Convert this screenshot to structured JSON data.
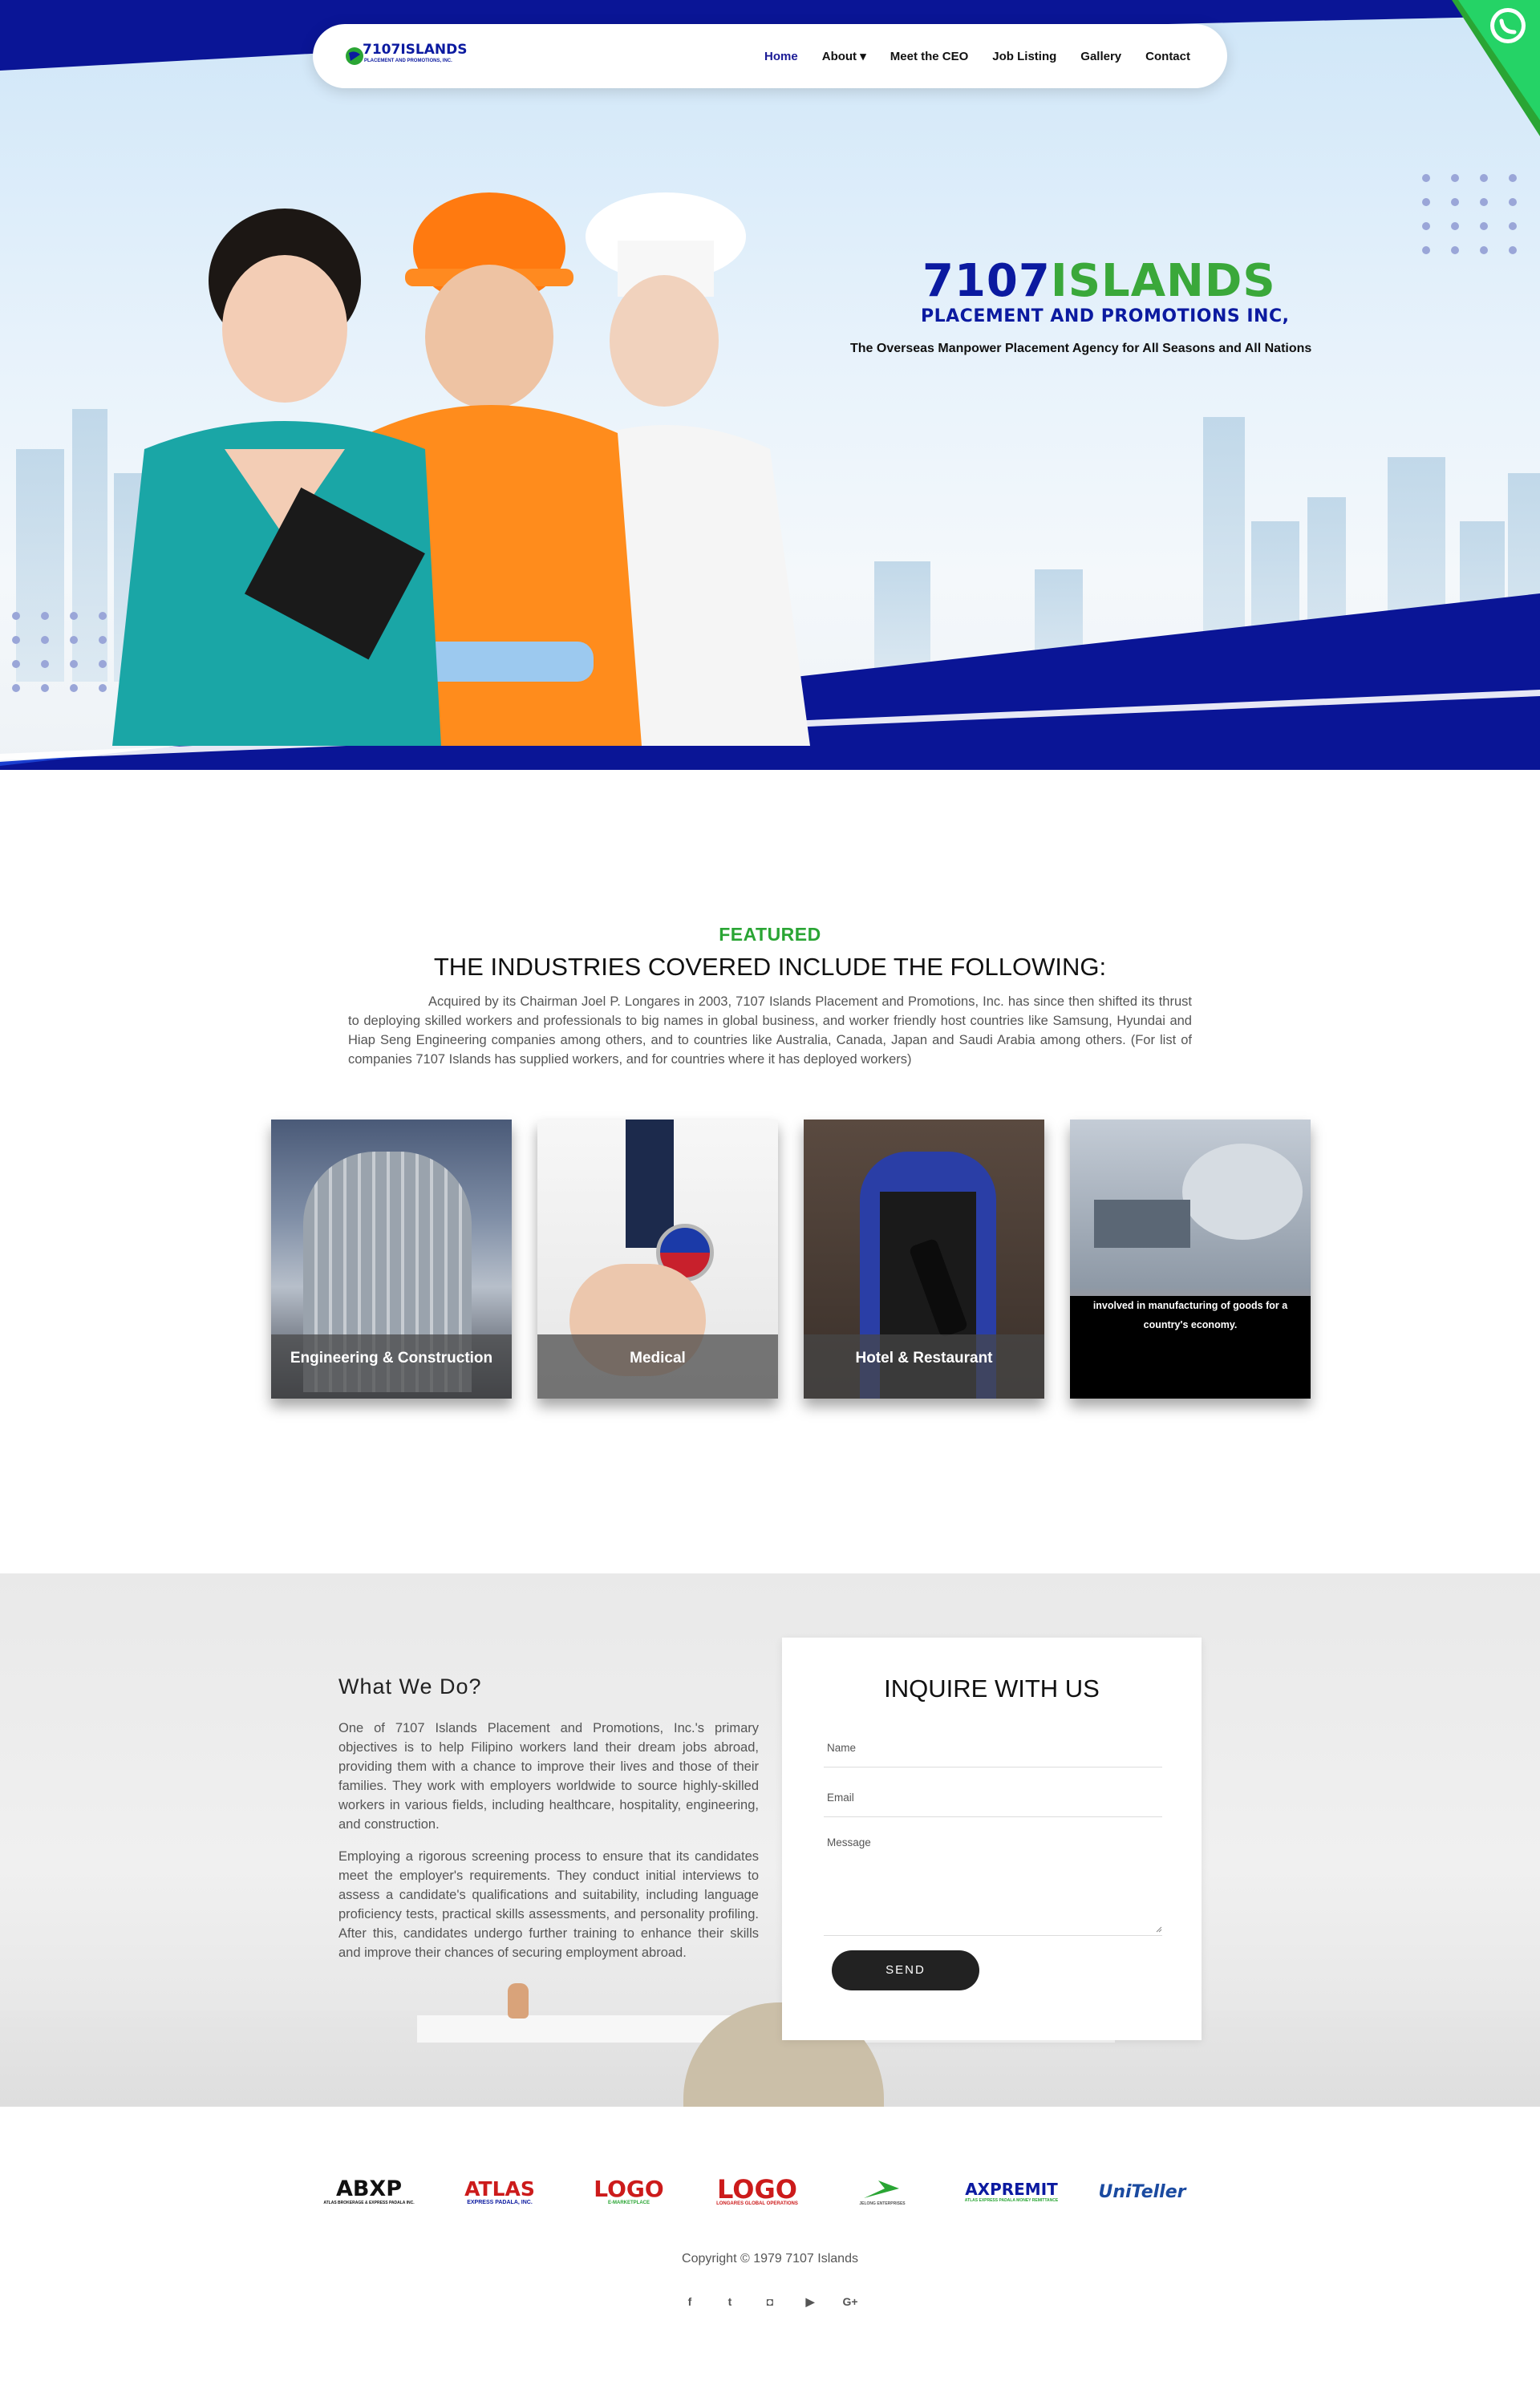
{
  "brand": {
    "logo_main": "7107ISLANDS",
    "logo_sub": "PLACEMENT AND PROMOTIONS, INC.",
    "colors": {
      "navy": "#0b1aa0",
      "green": "#3aa83a",
      "featured_green": "#2aa534",
      "whatsapp": "#25d366"
    }
  },
  "nav": {
    "items": [
      {
        "label": "Home",
        "active": true
      },
      {
        "label": "About",
        "dropdown": true,
        "caret": "▾"
      },
      {
        "label": "Meet the CEO"
      },
      {
        "label": "Job Listing"
      },
      {
        "label": "Gallery"
      },
      {
        "label": "Contact"
      }
    ]
  },
  "hero": {
    "title_num": "7107",
    "title_word": "ISLANDS",
    "subtitle": "PLACEMENT AND PROMOTIONS INC,",
    "tagline": "The Overseas Manpower Placement Agency for All Seasons and All Nations",
    "whatsapp_icon": "whatsapp-icon"
  },
  "featured": {
    "label": "FEATURED",
    "heading": "THE INDUSTRIES COVERED INCLUDE THE FOLLOWING:",
    "text": "Acquired by its Chairman Joel P. Longares in 2003, 7107 Islands Placement and Promotions, Inc. has since then shifted its thrust to deploying skilled workers and professionals to big names in global business, and worker friendly host countries like Samsung, Hyundai and Hiap Seng Engineering companies among others, and to countries like Australia, Canada, Japan and Saudi Arabia among others. (For list of companies 7107 Islands has supplied workers, and for countries where it has deployed workers)",
    "cards": [
      {
        "caption": "Engineering & Construction"
      },
      {
        "caption": "Medical"
      },
      {
        "caption": "Hotel & Restaurant"
      },
      {
        "overlay_text": "involved in manufacturing of goods for a country's economy."
      }
    ]
  },
  "what_we_do": {
    "title": "What We Do?",
    "p1": "One of 7107 Islands Placement and Promotions, Inc.'s primary objectives is to help Filipino workers land their dream jobs abroad, providing them with a chance to improve their lives and those of their families. They work with employers worldwide to source highly-skilled workers in various fields, including healthcare, hospitality, engineering, and construction.",
    "p2": "Employing a rigorous screening process to ensure that its candidates meet the employer's requirements. They conduct initial interviews to assess a candidate's qualifications and suitability, including language proficiency tests, practical skills assessments, and personality profiling. After this, candidates undergo further training to enhance their skills and improve their chances of securing employment abroad."
  },
  "inquiry": {
    "title": "INQUIRE WITH US",
    "name_label": "Name",
    "email_label": "Email",
    "message_label": "Message",
    "send_label": "SEND"
  },
  "partners": [
    {
      "name": "ABXP",
      "sub": "ATLAS BROKERAGE & EXPRESS PADALA INC.",
      "color": "#111111"
    },
    {
      "name": "ATLAS",
      "sub": "EXPRESS PADALA, INC.",
      "color": "#cc1b1b"
    },
    {
      "name": "LOGO",
      "sub": "E-MARKETPLACE",
      "color": "#cc1b1b"
    },
    {
      "name": "LOGO",
      "sub": "LONGARES GLOBAL OPERATIONS",
      "color": "#cc1b1b"
    },
    {
      "name": "",
      "sub": "JELONG ENTERPRISES",
      "color": "#2aa534"
    },
    {
      "name": "AXPREMIT",
      "sub": "ATLAS EXPRESS PADALA MONEY REMITTANCE",
      "color": "#0b1aa0"
    },
    {
      "name": "UniTeller",
      "sub": "",
      "color": "#1a4aa0"
    }
  ],
  "footer": {
    "copyright": "Copyright © 1979 7107 Islands",
    "socials": [
      {
        "icon": "facebook-icon",
        "glyph": "f"
      },
      {
        "icon": "twitter-icon",
        "glyph": "t"
      },
      {
        "icon": "instagram-icon",
        "glyph": "◘"
      },
      {
        "icon": "youtube-icon",
        "glyph": "▶"
      },
      {
        "icon": "google-plus-icon",
        "glyph": "G+"
      }
    ]
  }
}
